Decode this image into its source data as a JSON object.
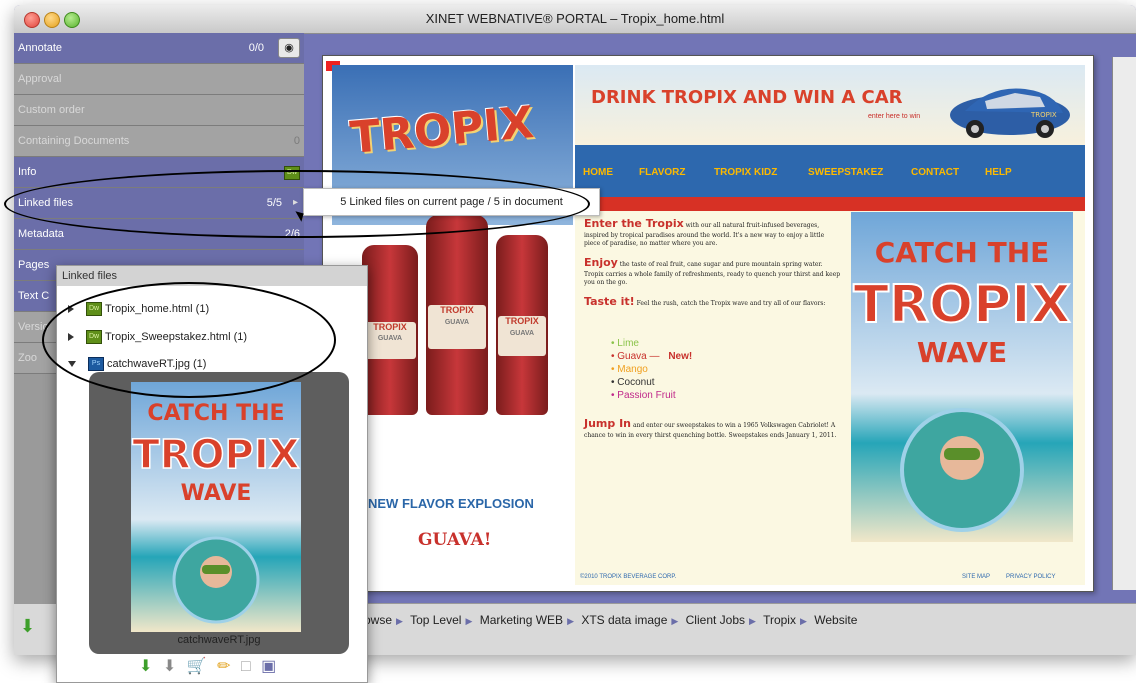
{
  "window": {
    "title": "XINET WEBNATIVE® PORTAL – Tropix_home.html"
  },
  "sidebar": {
    "rows": [
      {
        "label": "Annotate",
        "count": "0/0",
        "state": "active"
      },
      {
        "label": "Approval",
        "count": "",
        "state": "inactive"
      },
      {
        "label": "Custom order",
        "count": "",
        "state": "inactive"
      },
      {
        "label": "Containing Documents",
        "count": "0",
        "state": "inactive"
      },
      {
        "label": "Info",
        "count": "",
        "state": "active"
      },
      {
        "label": "Linked files",
        "count": "5/5",
        "state": "active"
      },
      {
        "label": "Metadata",
        "count": "2/6",
        "state": "active"
      },
      {
        "label": "Pages",
        "count": "",
        "state": "active"
      },
      {
        "label": "Text C",
        "count": "",
        "state": "active"
      },
      {
        "label": "Versio",
        "count": "",
        "state": "inactive"
      },
      {
        "label": "Zoo",
        "count": "",
        "state": "inactive"
      }
    ]
  },
  "tooltip": {
    "text": "5 Linked files on current page / 5 in document"
  },
  "popup": {
    "title": "Linked files",
    "files": [
      {
        "name": "Tropix_home.html (1)",
        "type": "Dw",
        "expanded": false
      },
      {
        "name": "Tropix_Sweepstakez.html (1)",
        "type": "Dw",
        "expanded": false
      },
      {
        "name": "catchwaveRT.jpg (1)",
        "type": "Ps",
        "expanded": true
      }
    ],
    "preview_caption": "catchwaveRT.jpg",
    "thumb_line1": "CATCH THE",
    "thumb_line2": "TROPIX",
    "thumb_line3": "WAVE"
  },
  "breadcrumb": {
    "items": [
      "Browse",
      "Top Level",
      "Marketing WEB",
      "XTS data image",
      "Client Jobs",
      "Tropix",
      "Website"
    ]
  },
  "page": {
    "left": {
      "logo": "TROPIX",
      "bottle_label": "TROPIX",
      "bottle_sub": "GUAVA",
      "tagline": "NEW FLAVOR EXPLOSION",
      "flavor": "GUAVA!"
    },
    "banner": {
      "title": "DRINK TROPIX AND WIN A CAR",
      "sub": "enter here to win",
      "car_label": "TROPIX"
    },
    "nav": [
      "HOME",
      "FLAVORZ",
      "TROPIX KIDZ",
      "SWEEPSTAKEZ",
      "CONTACT",
      "HELP"
    ],
    "body": {
      "p1_head": "Enter the Tropix",
      "p1_text": "with our all natural fruit-infused beverages, inspired by tropical paradises around the world. It's a new way to enjoy a little piece of paradise, no matter where you are.",
      "p2_head": "Enjoy",
      "p2_text": "the taste of real fruit, cane sugar and pure mountain spring water. Tropix carries a whole family of refreshments, ready to quench your thirst and keep you on the go.",
      "p3_head": "Taste it!",
      "p3_text": "Feel the rush, catch the Tropix wave and try all of our flavors:",
      "flavors": [
        {
          "name": "Lime",
          "color": "#8bc34a"
        },
        {
          "name": "Guava —",
          "color": "#c8312c"
        },
        {
          "name": "Mango",
          "color": "#f0a020"
        },
        {
          "name": "Coconut",
          "color": "#333333"
        },
        {
          "name": "Passion Fruit",
          "color": "#c0288a"
        }
      ],
      "new_tag": "New!",
      "p4_head": "Jump In",
      "p4_text": "and enter our sweepstakes to win a 1965 Volkswagen Cabriolet! A chance to win in every thirst quenching bottle. Sweepstakes ends January 1, 2011."
    },
    "hero": {
      "line1": "CATCH THE",
      "line2": "TROPIX",
      "line3": "WAVE"
    },
    "footer": {
      "copyright": "©2010 TROPIX BEVERAGE CORP.",
      "sitemap": "SITE MAP",
      "privacy": "PRIVACY POLICY"
    }
  },
  "colors": {
    "accent": "#6b6ea9",
    "nav_blue": "#2d68ae",
    "brand_red": "#d73125",
    "brand_yellow": "#fcb900"
  }
}
